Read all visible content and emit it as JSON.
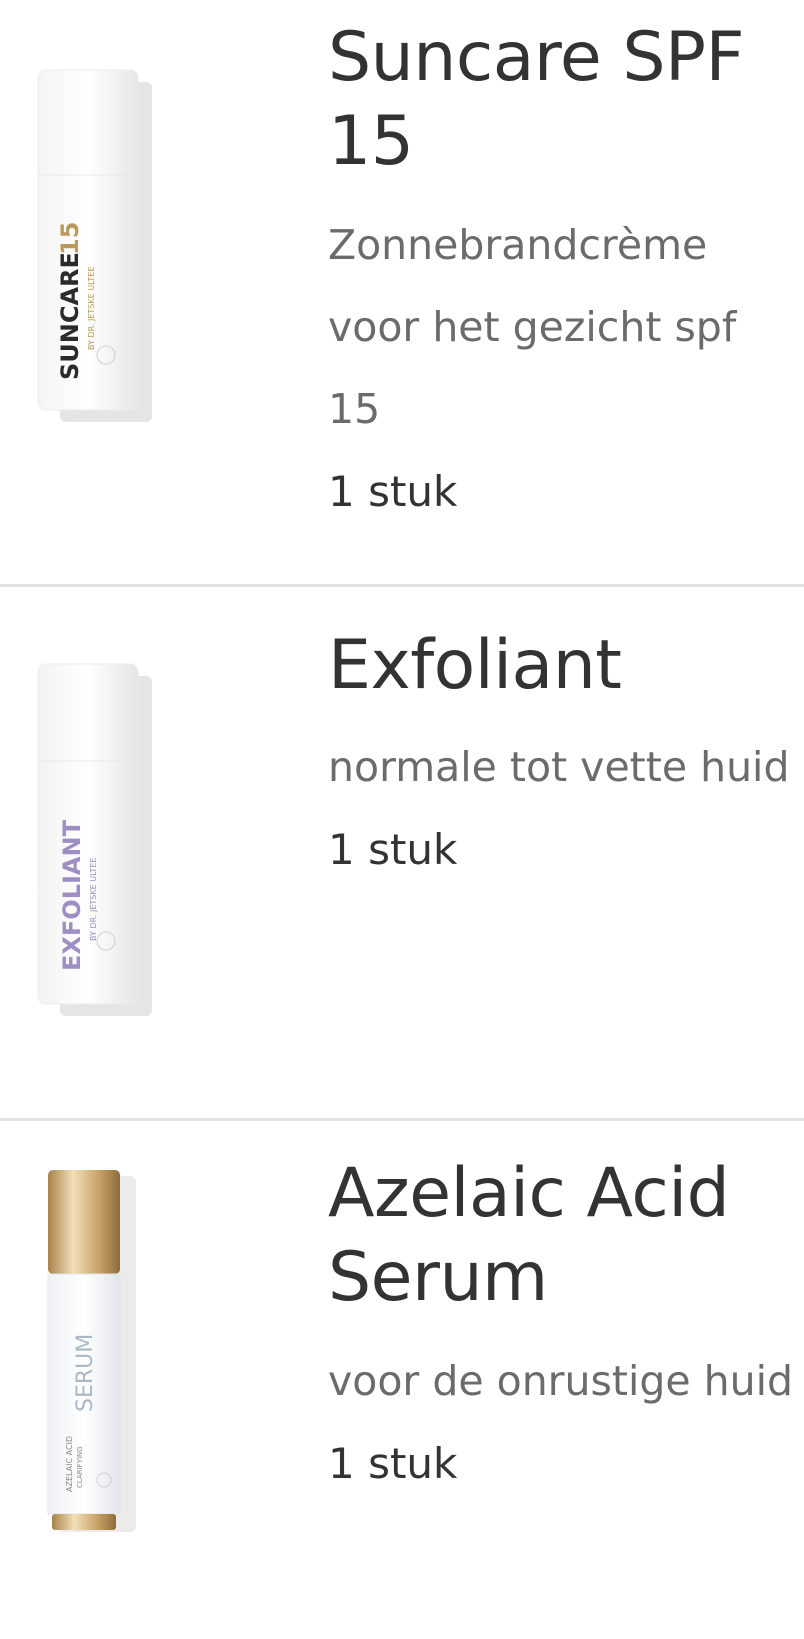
{
  "products": [
    {
      "title": "Suncare SPF 15",
      "subtitle": "Zonnebrandcrème voor het gezicht spf 15",
      "quantity": "1 stuk",
      "image": {
        "label_main": "SUNCARE",
        "label_number": "15",
        "label_sub": "BY DR. JETSKE ULTEE",
        "accent_color": "#b89a5a",
        "text_color": "#2b2b2b"
      }
    },
    {
      "title": "Exfoliant",
      "subtitle": "normale tot vette huid",
      "quantity": "1 stuk",
      "image": {
        "label_main": "EXFOLIANT",
        "label_sub": "BY DR. JETSKE ULTEE",
        "accent_color": "#9d8fc4"
      }
    },
    {
      "title": "Azelaic Acid Serum",
      "subtitle": "voor de onrustige huid",
      "quantity": "1 stuk",
      "image": {
        "label_main": "SERUM",
        "label_sub": "AZELAIC ACID",
        "label_sub2": "CLARIFYING",
        "cap_color": "#c9a46a",
        "accent_color": "#a9b9c8"
      }
    }
  ],
  "colors": {
    "title": "#333333",
    "subtitle": "#6b6b6b",
    "divider": "#e2e2e2"
  }
}
